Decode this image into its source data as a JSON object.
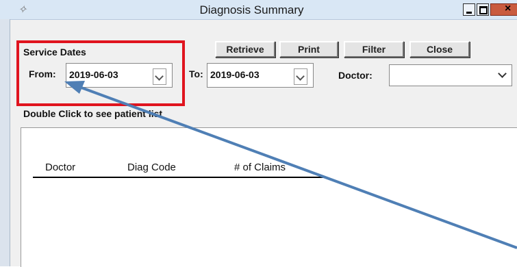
{
  "window": {
    "title": "Diagnosis Summary",
    "icon": "feather-icon",
    "controls": [
      "minimize",
      "maximize",
      "close"
    ]
  },
  "service_dates": {
    "label": "Service Dates",
    "from_label": "From:",
    "from_value": "2019-06-03",
    "to_label": "To:",
    "to_value": "2019-06-03"
  },
  "doctor": {
    "label": "Doctor:",
    "value": ""
  },
  "toolbar": {
    "retrieve_label": "Retrieve",
    "print_label": "Print",
    "filter_label": "Filter",
    "close_label": "Close"
  },
  "results": {
    "hint": "Double Click to see patient list",
    "columns": [
      "Doctor",
      "Diag Code",
      "# of Claims"
    ]
  },
  "annotation": {
    "highlight_color": "#e0141e",
    "arrow_color": "#4f7fb5"
  }
}
